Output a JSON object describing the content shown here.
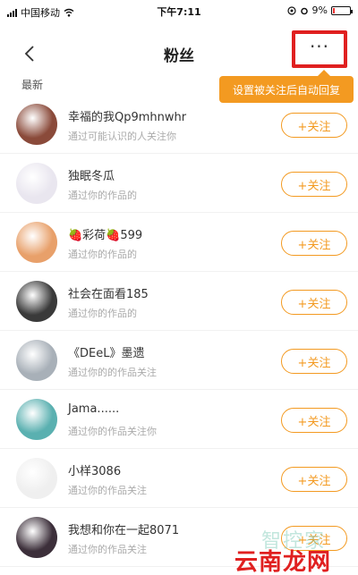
{
  "status_bar": {
    "carrier": "中国移动",
    "time": "下午7:11",
    "battery": "9%",
    "battery_level": 0.09
  },
  "nav": {
    "title": "粉丝",
    "more_label": "···"
  },
  "tooltip": {
    "text": "设置被关注后自动回复"
  },
  "section": {
    "label": "最新"
  },
  "follow_label": "+关注",
  "followers": [
    {
      "name": "幸福的我Qp9mhnwhr",
      "sub": "通过可能认识的人关注你"
    },
    {
      "name": "独眠冬瓜",
      "sub": "通过你的作品的"
    },
    {
      "name": "🍓彩荷🍓599",
      "sub": "通过你的作品的"
    },
    {
      "name": "社会在面看185",
      "sub": "通过你的作品的"
    },
    {
      "name": "《DEeL》墨遗",
      "sub": "通过你的的作品关注"
    },
    {
      "name": "Jama......",
      "sub": "通过你的作品关注你"
    },
    {
      "name": "小样3086",
      "sub": "通过你的作品关注"
    },
    {
      "name": "我想和你在一起8071",
      "sub": "通过你的作品关注"
    }
  ],
  "avatar_colors": [
    "#8a4a3a",
    "#e9e6ef",
    "#e8a06a",
    "#3a3a3a",
    "#a8b0b8",
    "#5ab0b0",
    "#efefef",
    "#3c2f3a"
  ],
  "watermark": {
    "top": "智控家",
    "main": "云南龙网"
  }
}
